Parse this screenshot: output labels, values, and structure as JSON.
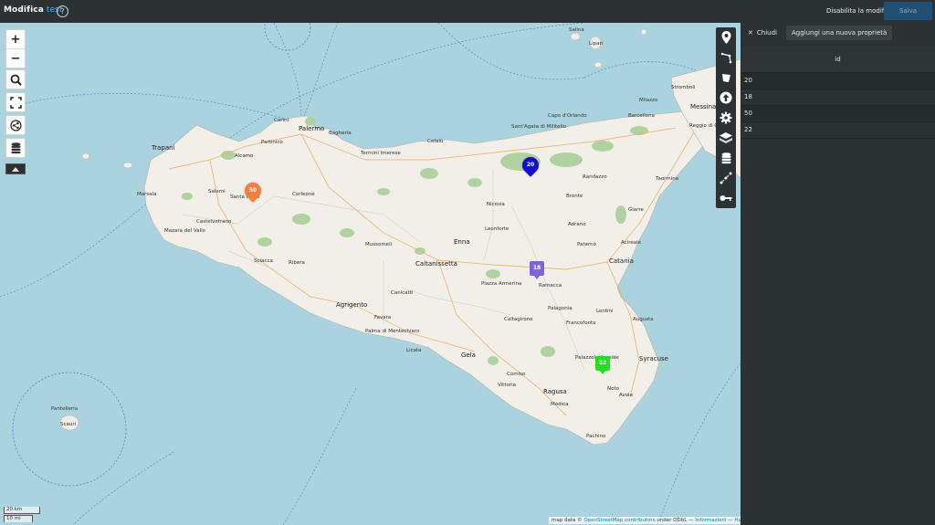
{
  "header": {
    "title": "Modifica",
    "map_name": "test",
    "help_label": "?",
    "disable_edit_label": "Disabilita la modifica",
    "save_label": "Salva"
  },
  "map": {
    "zoom_in_label": "+",
    "zoom_out_label": "−",
    "scale_metric": "20 km",
    "scale_imperial": "10 mi",
    "attribution": {
      "prefix": "map data ©",
      "osm_link": "OpenStreetMap contributors",
      "license": "under ODbL",
      "sep1": "—",
      "info_link": "Informazioni",
      "sep2": "—",
      "home_link": "Home"
    },
    "markers": [
      {
        "label": "50",
        "color": "#f08040",
        "shape": "pin"
      },
      {
        "label": "20",
        "color": "#1010c8",
        "shape": "pin"
      },
      {
        "label": "18",
        "color": "#8060e0",
        "shape": "square"
      },
      {
        "label": "22",
        "color": "#20e020",
        "shape": "square"
      }
    ],
    "places": {
      "palermo": "Palermo",
      "trapani": "Trapani",
      "marsala": "Marsala",
      "mazara": "Mazara del Vallo",
      "castelvetrano": "Castelvetrano",
      "alcamo": "Alcamo",
      "salemi": "Salemi",
      "corleone": "Corleone",
      "sciacca": "Sciacca",
      "ribera": "Ribera",
      "agrigento": "Agrigento",
      "licata": "Licata",
      "gela": "Gela",
      "caltanissetta": "Caltanissetta",
      "enna": "Enna",
      "nicosia": "Nicosia",
      "cefalu": "Cefalù",
      "termini": "Termini Imerese",
      "bronte": "Bronte",
      "randazzo": "Randazzo",
      "adrano": "Adrano",
      "paterno": "Paternò",
      "catania": "Catania",
      "acireale": "Acireale",
      "giarre": "Giarre",
      "taormina": "Taormina",
      "messina": "Messina",
      "milazzo": "Milazzo",
      "barcellona": "Barcellona",
      "capo_orlando": "Capo d'Orlando",
      "santagata": "Sant'Agata di Militello",
      "lipari": "Lipari",
      "salina": "Salina",
      "stromboli": "Stromboli",
      "reggio": "Reggio di Calabria",
      "augusta": "Augusta",
      "lentini": "Lentini",
      "siracusa": "Syracuse",
      "noto": "Noto",
      "avola": "Avola",
      "modica": "Modica",
      "ragusa": "Ragusa",
      "vittoria": "Vittoria",
      "comiso": "Comiso",
      "pachino": "Pachino",
      "caltagirone": "Caltagirone",
      "piazza": "Piazza Armerina",
      "ramacca": "Ramacca",
      "palagonia": "Palagonia",
      "leonforte": "Leonforte",
      "canicatti": "Canicattì",
      "favara": "Favara",
      "palma": "Palma di Montechiaro",
      "mussomeli": "Mussomeli",
      "partinico": "Partinico",
      "bagheria": "Bagheria",
      "carini": "Carini",
      "pantelleria": "Pantelleria",
      "scauri": "Scauri",
      "santa_ninfa": "Santa Ninfa",
      "francofonte": "Francofonte",
      "palazzolo": "Palazzolo Acreide"
    }
  },
  "panel": {
    "close_label": "Chiudi",
    "add_property_label": "Aggiungi una nuova proprietà",
    "column_header": "id",
    "rows": [
      "20",
      "18",
      "50",
      "22"
    ]
  },
  "colors": {
    "sea": "#aad3df",
    "land": "#f2efe9",
    "header_bg": "#2c3233",
    "accent": "#44b3ea",
    "save_bg": "#224f74"
  }
}
